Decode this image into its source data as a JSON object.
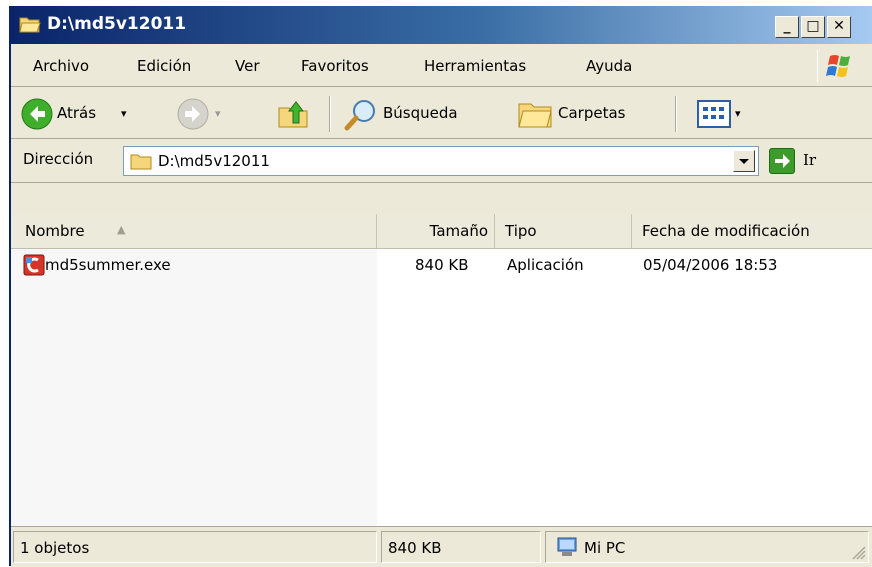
{
  "window": {
    "title": "D:\\md5v12011",
    "minimize_glyph": "_",
    "maximize_glyph": "□",
    "close_glyph": "✕"
  },
  "menu": [
    "Archivo",
    "Edición",
    "Ver",
    "Favoritos",
    "Herramientas",
    "Ayuda"
  ],
  "toolbar": {
    "back_label": "Atrás",
    "search_label": "Búsqueda",
    "folders_label": "Carpetas",
    "dropdown_glyph": "▾"
  },
  "address": {
    "label": "Dirección",
    "value": "D:\\md5v12011",
    "go_label": "Ir"
  },
  "columns": {
    "name": "Nombre",
    "size": "Tamaño",
    "type": "Tipo",
    "modified": "Fecha de modificación",
    "sort_glyph": "▲"
  },
  "files": [
    {
      "name": "md5summer.exe",
      "size": "840 KB",
      "type": "Aplicación",
      "modified": "05/04/2006 18:53",
      "icon": "app-exe-icon"
    }
  ],
  "status": {
    "objects": "1 objetos",
    "size": "840 KB",
    "location": "Mi PC"
  },
  "colors": {
    "title_start": "#0a246a",
    "title_end": "#a6caf0",
    "chrome": "#ece9d8",
    "go_green": "#3c9b2a"
  }
}
